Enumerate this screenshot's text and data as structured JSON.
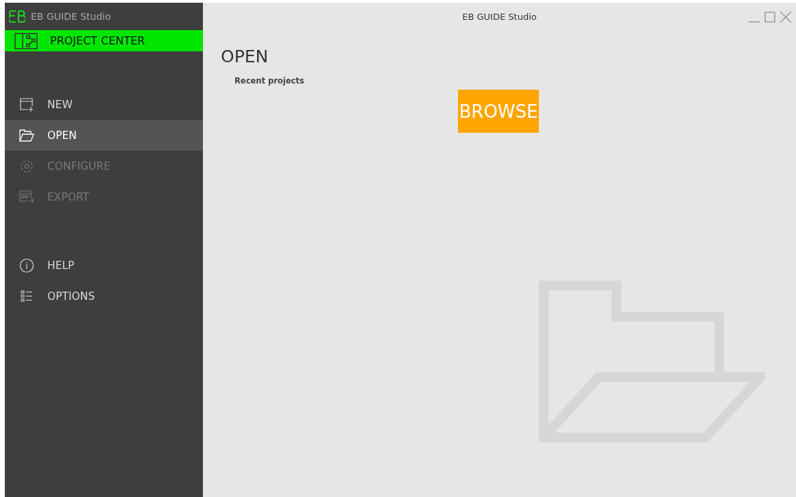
{
  "app": {
    "title": "EB GUIDE Studio"
  },
  "project_center": {
    "label": "PROJECT CENTER"
  },
  "sidebar": {
    "items": [
      {
        "kind": "new",
        "label": "NEW",
        "selected": false,
        "disabled": false
      },
      {
        "kind": "open",
        "label": "OPEN",
        "selected": true,
        "disabled": false
      },
      {
        "kind": "configure",
        "label": "CONFIGURE",
        "selected": false,
        "disabled": true
      },
      {
        "kind": "export",
        "label": "EXPORT",
        "selected": false,
        "disabled": true
      }
    ],
    "lower_items": [
      {
        "kind": "help",
        "label": "HELP",
        "selected": false,
        "disabled": false
      },
      {
        "kind": "options",
        "label": "OPTIONS",
        "selected": false,
        "disabled": false
      }
    ]
  },
  "window": {
    "title": "EB GUIDE Studio"
  },
  "main": {
    "heading": "OPEN",
    "recent_label": "Recent projects",
    "browse_button": "BROWSE"
  }
}
